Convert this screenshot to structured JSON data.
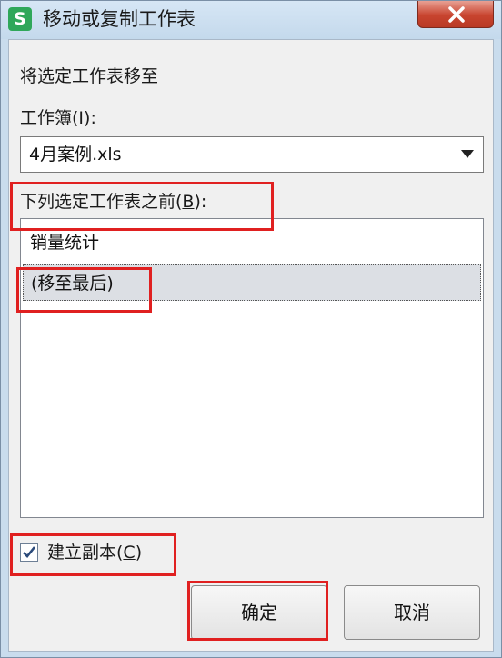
{
  "window": {
    "title": "移动或复制工作表",
    "app_icon_letter": "S",
    "app_icon_color": "#2fa75a"
  },
  "dialog": {
    "move_to_label": "将选定工作表移至",
    "workbook_label": "工作簿(",
    "workbook_hotkey": "I",
    "workbook_label_end": "):",
    "workbook_value": "4月案例.xls",
    "before_label": "下列选定工作表之前(",
    "before_hotkey": "B",
    "before_label_end": "):",
    "sheets": [
      "销量统计",
      "(移至最后)"
    ],
    "selected_sheet_index": 1,
    "copy_label": "建立副本(",
    "copy_hotkey": "C",
    "copy_label_end": ")",
    "copy_checked": true,
    "ok_label": "确定",
    "cancel_label": "取消"
  },
  "colors": {
    "highlight": "#e02020",
    "close_button": "#c8442f"
  }
}
